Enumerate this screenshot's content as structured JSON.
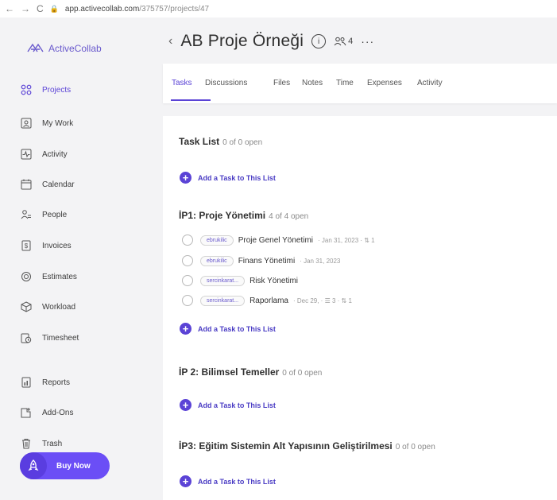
{
  "browser": {
    "url_host": "app.activecollab.com",
    "url_path": "/375757/projects/47"
  },
  "app": {
    "name": "ActiveCollab"
  },
  "sidebar": {
    "items": [
      {
        "label": "Projects",
        "icon": "projects-icon"
      },
      {
        "label": "My Work",
        "icon": "my-work-icon"
      },
      {
        "label": "Activity",
        "icon": "activity-icon"
      },
      {
        "label": "Calendar",
        "icon": "calendar-icon"
      },
      {
        "label": "People",
        "icon": "people-icon"
      },
      {
        "label": "Invoices",
        "icon": "invoices-icon"
      },
      {
        "label": "Estimates",
        "icon": "estimates-icon"
      },
      {
        "label": "Workload",
        "icon": "workload-icon"
      },
      {
        "label": "Timesheet",
        "icon": "timesheet-icon"
      },
      {
        "label": "Reports",
        "icon": "reports-icon"
      },
      {
        "label": "Add-Ons",
        "icon": "add-ons-icon"
      },
      {
        "label": "Trash",
        "icon": "trash-icon"
      }
    ],
    "buy_now": "Buy Now"
  },
  "header": {
    "title": "AB Proje Örneği",
    "info": "i",
    "members_count": "4",
    "more": "···"
  },
  "tabs": [
    "Tasks",
    "Discussions",
    "Files",
    "Notes",
    "Time",
    "Expenses",
    "Activity"
  ],
  "add_task_label": "Add a Task to This List",
  "task_lists": [
    {
      "title": "Task List",
      "count": "0 of 0 open",
      "tasks": []
    },
    {
      "title": "İP1: Proje Yönetimi",
      "count": "4 of 4 open",
      "tasks": [
        {
          "assignee": "ebrukilic",
          "name": "Proje Genel Yönetimi",
          "meta": "· Jan 31, 2023 · ⇅ 1"
        },
        {
          "assignee": "ebrukilic",
          "name": "Finans Yönetimi",
          "meta": "· Jan 31, 2023"
        },
        {
          "assignee": "sercinkarat...",
          "name": "Risk Yönetimi",
          "meta": ""
        },
        {
          "assignee": "sercinkarat...",
          "name": "Raporlama",
          "meta": "· Dec 29, · ☰ 3 · ⇅ 1"
        }
      ]
    },
    {
      "title": "İP 2: Bilimsel Temeller",
      "count": "0 of 0 open",
      "tasks": []
    },
    {
      "title": "İP3: Eğitim Sistemin Alt Yapısının Geliştirilmesi",
      "count": "0 of 0 open",
      "tasks": []
    }
  ],
  "colors": {
    "accent": "#5b43d6",
    "buy_button": "#6b4ef6"
  }
}
